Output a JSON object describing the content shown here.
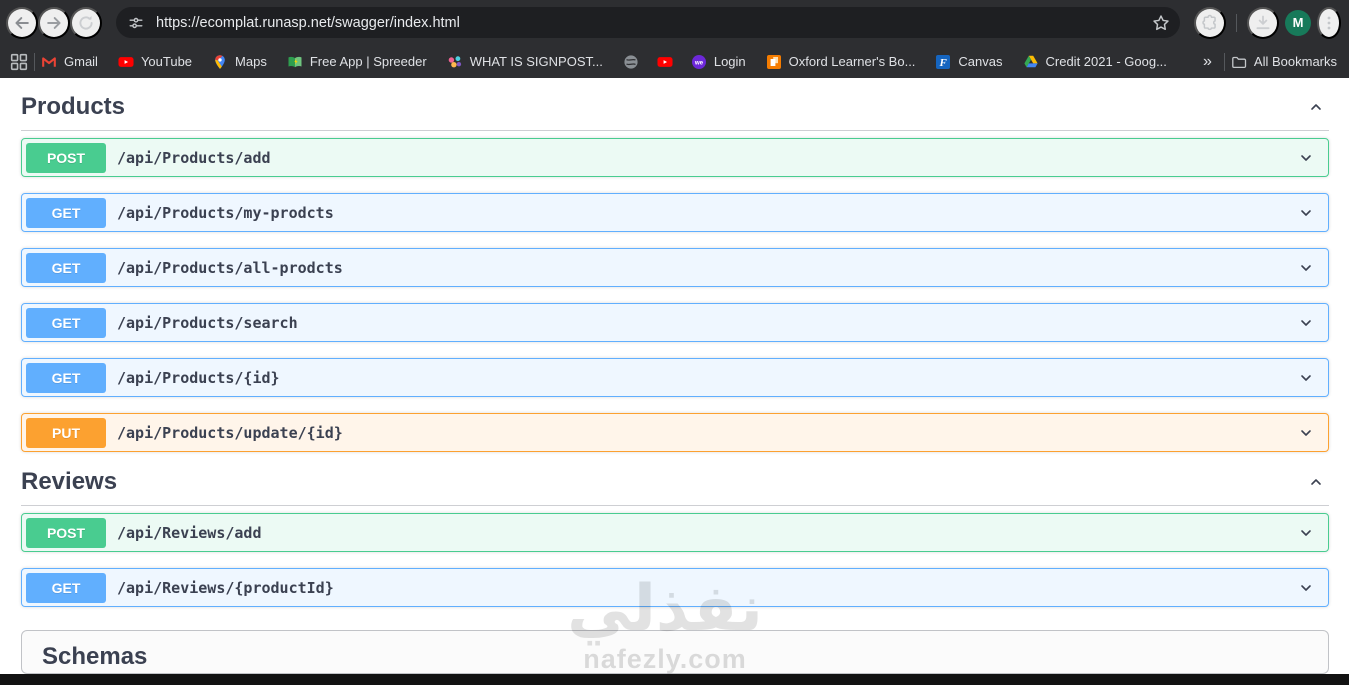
{
  "browser": {
    "url": "https://ecomplat.runasp.net/swagger/index.html",
    "avatar_letter": "M",
    "bookmarks_overflow": "»",
    "all_bookmarks_label": "All Bookmarks",
    "bookmarks": [
      {
        "label": "Gmail",
        "icon": "gmail-icon"
      },
      {
        "label": "YouTube",
        "icon": "youtube-icon"
      },
      {
        "label": "Maps",
        "icon": "maps-icon"
      },
      {
        "label": "Free App | Spreeder",
        "icon": "book-icon"
      },
      {
        "label": "WHAT IS SIGNPOST...",
        "icon": "signpost-icon"
      },
      {
        "label": "",
        "icon": "globe-icon"
      },
      {
        "label": "",
        "icon": "youtube-icon"
      },
      {
        "label": "Login",
        "icon": "we-icon"
      },
      {
        "label": "Oxford Learner's Bo...",
        "icon": "oxford-icon"
      },
      {
        "label": "Canvas",
        "icon": "canvas-icon"
      },
      {
        "label": "Credit 2021 - Goog...",
        "icon": "drive-icon"
      }
    ],
    "icons": {
      "back-icon": "left arrow",
      "forward-icon": "right arrow",
      "refresh-icon": "reload circle",
      "site-settings-icon": "tune sliders",
      "star-icon": "bookmark star outline",
      "extensions-icon": "puzzle piece",
      "download-icon": "down arrow tray",
      "menu-dots-icon": "vertical ellipsis",
      "apps-grid-icon": "four squares",
      "folder-icon": "bookmarks folder"
    }
  },
  "api": {
    "sections": [
      {
        "title": "Products",
        "operations": [
          {
            "method": "POST",
            "path": "/api/Products/add"
          },
          {
            "method": "GET",
            "path": "/api/Products/my-prodcts"
          },
          {
            "method": "GET",
            "path": "/api/Products/all-prodcts"
          },
          {
            "method": "GET",
            "path": "/api/Products/search"
          },
          {
            "method": "GET",
            "path": "/api/Products/{id}"
          },
          {
            "method": "PUT",
            "path": "/api/Products/update/{id}"
          }
        ]
      },
      {
        "title": "Reviews",
        "operations": [
          {
            "method": "POST",
            "path": "/api/Reviews/add"
          },
          {
            "method": "GET",
            "path": "/api/Reviews/{productId}"
          }
        ]
      }
    ],
    "schemas_title": "Schemas",
    "method_colors": {
      "POST": "#49cc90",
      "GET": "#61affe",
      "PUT": "#fca130"
    },
    "method_backgrounds": {
      "POST": "rgba(73,204,144,0.1)",
      "GET": "rgba(97,175,254,0.1)",
      "PUT": "rgba(252,161,48,0.1)"
    },
    "text_color": "#3b4151"
  },
  "watermark": {
    "arabic": "نفذلي",
    "domain": "nafezly.com"
  }
}
